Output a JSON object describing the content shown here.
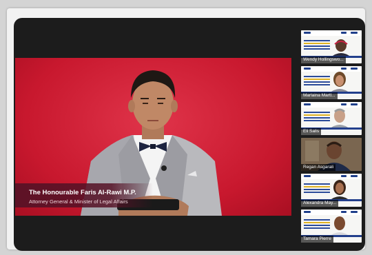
{
  "main_stage": {
    "speaker_name": "The Honourable Faris Al-Rawi M.P.",
    "speaker_title": "Attorney General & Minister of Legal Affairs"
  },
  "participants": [
    {
      "name": "Wendy Hollingswo..."
    },
    {
      "name": "Marlaina Martl..."
    },
    {
      "name": "Eli Salis"
    },
    {
      "name": "Regan Asgarali"
    },
    {
      "name": "Alexandra May..."
    },
    {
      "name": "Tamara Pierre"
    }
  ],
  "colors": {
    "stage_background": "#c8182e",
    "lower_third": "#561226",
    "slide_accent": "#233f8c",
    "window_background": "#1c1c1c"
  }
}
